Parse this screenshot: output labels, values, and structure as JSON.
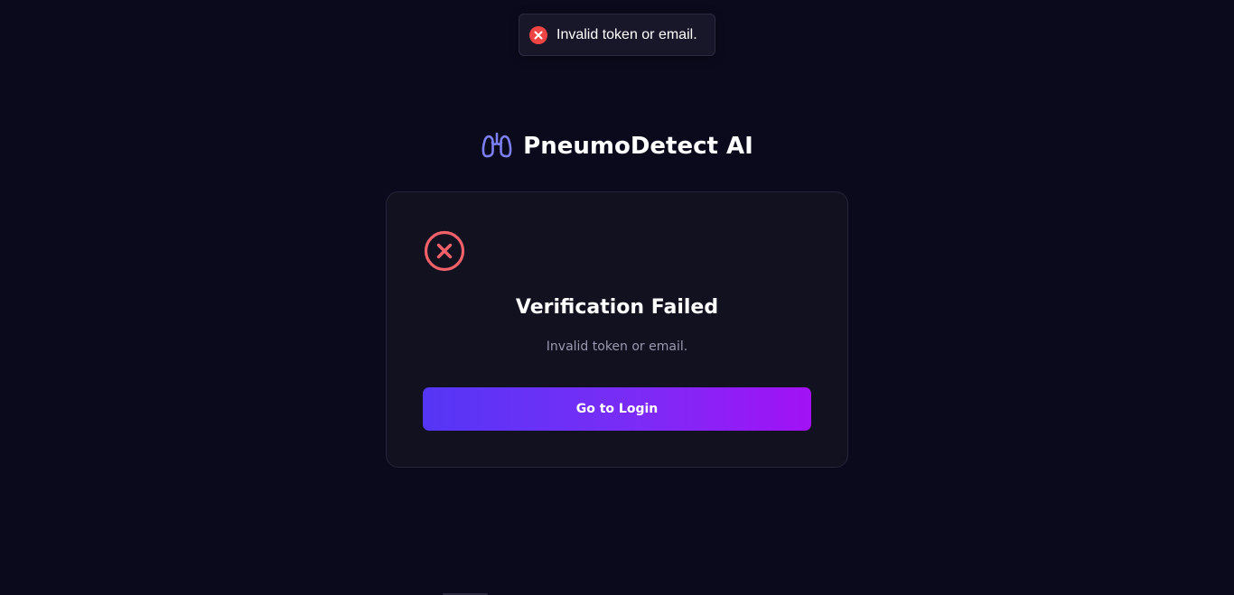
{
  "toast": {
    "icon": "error-circle-icon",
    "message": "Invalid token or email.",
    "accent_color": "#ef4444"
  },
  "brand": {
    "icon": "lungs-icon",
    "title": "PneumoDetect AI",
    "icon_color": "#7c7ff0"
  },
  "card": {
    "status_icon": "x-circle-icon",
    "status_color": "#f0616a",
    "title": "Verification Failed",
    "message": "Invalid token or email.",
    "button_label": "Go to Login",
    "button_gradient": [
      "#5536f6",
      "#a211f5"
    ]
  }
}
